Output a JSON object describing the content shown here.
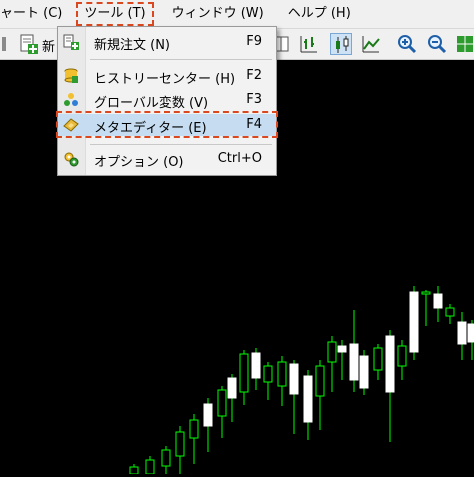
{
  "menubar": {
    "items": [
      {
        "label": "ャート (C)"
      },
      {
        "label": "ツール (T)"
      },
      {
        "label": "ウィンドウ (W)"
      },
      {
        "label": "ヘルプ (H)"
      }
    ]
  },
  "toolbar": {
    "new_label": "新",
    "icons": [
      "new-order-icon",
      "new-order-icon",
      "tile-windows-icon",
      "bar-chart-icon",
      "candlestick-chart-icon",
      "line-chart-icon",
      "zoom-in-icon",
      "zoom-out-icon",
      "grid-icon"
    ]
  },
  "tools_menu": {
    "items": [
      {
        "label": "新規注文 (N)",
        "shortcut": "F9",
        "icon": "new-order-icon"
      },
      {
        "label": "ヒストリーセンター (H)",
        "shortcut": "F2",
        "icon": "history-center-icon"
      },
      {
        "label": "グローバル変数 (V)",
        "shortcut": "F3",
        "icon": "global-variables-icon"
      },
      {
        "label": "メタエディター (E)",
        "shortcut": "F4",
        "icon": "meta-editor-icon"
      },
      {
        "label": "オプション (O)",
        "shortcut": "Ctrl+O",
        "icon": "options-icon"
      }
    ]
  },
  "colors": {
    "menu_bg": "#f0f0f0",
    "chart_bg": "#000000",
    "bull_candle": "#ffffff",
    "wick": "#00ff00",
    "highlight_dash": "#d9481f",
    "selected_item": "#c5dcf1"
  }
}
